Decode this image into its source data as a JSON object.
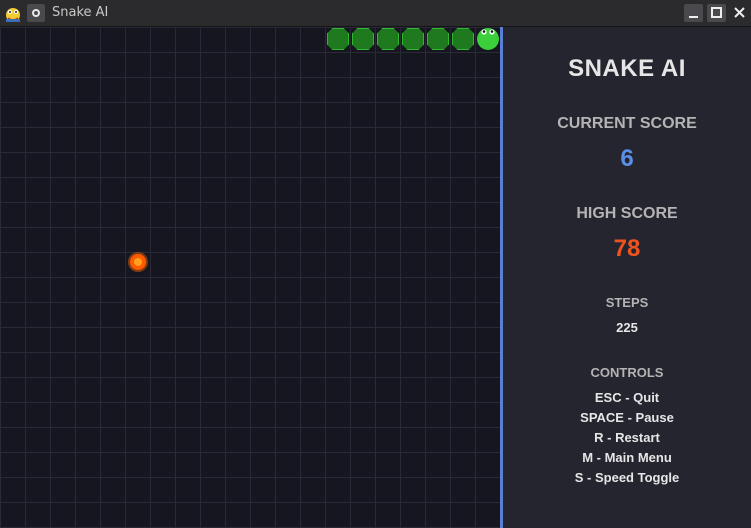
{
  "window": {
    "title": "Snake AI"
  },
  "panel": {
    "title": "SNAKE AI",
    "current_score_label": "CURRENT SCORE",
    "current_score": "6",
    "high_score_label": "HIGH SCORE",
    "high_score": "78",
    "steps_label": "STEPS",
    "steps": "225",
    "controls_label": "CONTROLS",
    "controls": [
      "ESC - Quit",
      "SPACE - Pause",
      "R - Restart",
      "M - Main Menu",
      "S - Speed Toggle"
    ]
  },
  "colors": {
    "accent": "#5a8fe6",
    "high_score": "#f0541e",
    "snake_body": "#1f7a1f",
    "snake_head": "#3ccf3c",
    "food": "#ff6a00",
    "divider": "#5a7fd6"
  },
  "icons": [
    "pygame-snake-icon",
    "menu-circle-icon",
    "minimize-icon",
    "maximize-icon",
    "close-icon"
  ]
}
